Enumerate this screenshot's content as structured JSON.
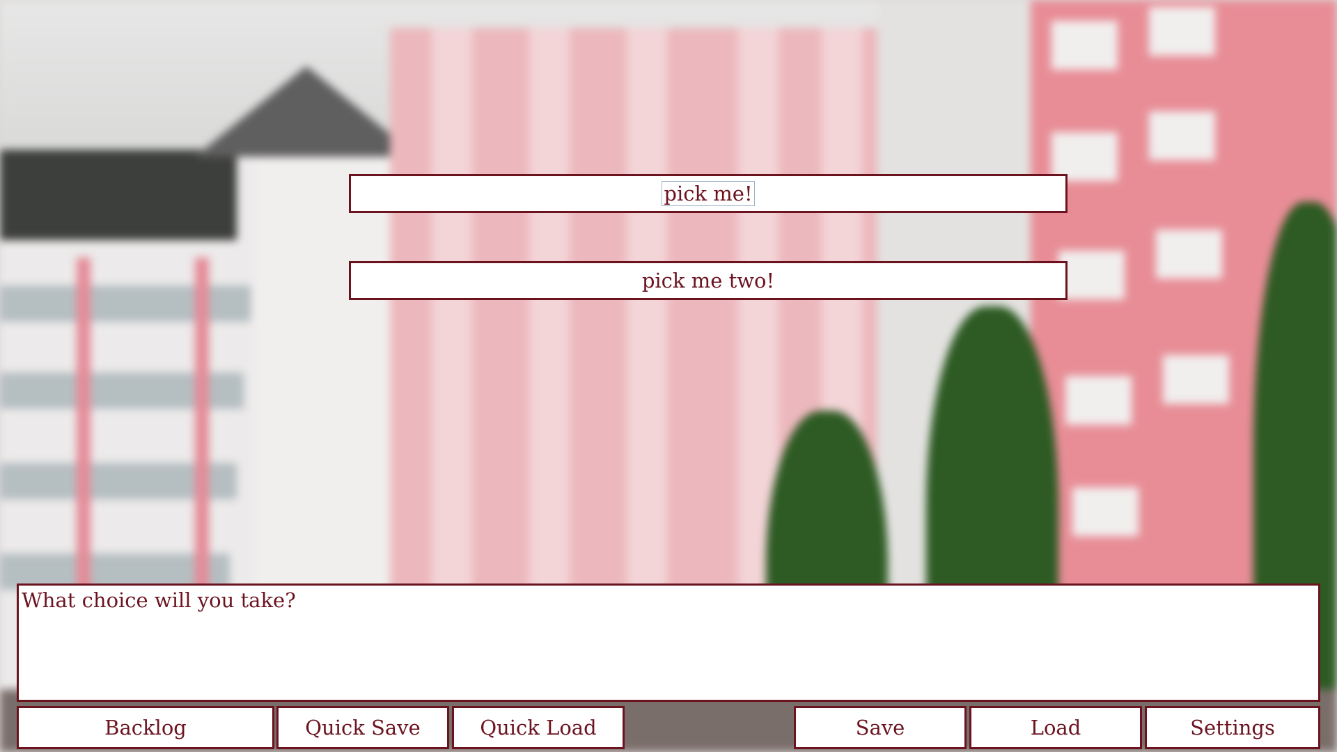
{
  "scene": {
    "choices": [
      {
        "label": "pick me!"
      },
      {
        "label": "pick me two!"
      }
    ],
    "dialogue_text": "What choice will you take?"
  },
  "menu": {
    "backlog": "Backlog",
    "quick_save": "Quick Save",
    "quick_load": "Quick Load",
    "save": "Save",
    "load": "Load",
    "settings": "Settings"
  },
  "colors": {
    "accent": "#6b1420",
    "panel": "#ffffff"
  }
}
